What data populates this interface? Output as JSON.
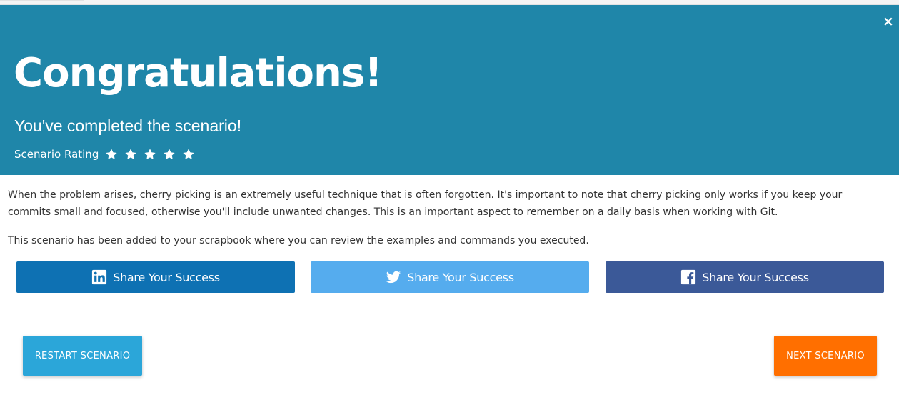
{
  "header": {
    "close_label": "×",
    "title": "Congratulations!",
    "subtitle": "You've completed the scenario!",
    "rating": {
      "label": "Scenario Rating",
      "stars": 5,
      "icon": "star-icon"
    }
  },
  "content": {
    "paragraph_1": "When the problem arises, cherry picking is an extremely useful technique that is often forgotten. It's important to note that cherry picking only works if you keep your commits small and focused, otherwise you'll include unwanted changes. This is an important aspect to remember on a daily basis when working with Git.",
    "paragraph_2": "This scenario has been added to your scrapbook where you can review the examples and commands you executed."
  },
  "share": [
    {
      "network": "linkedin",
      "icon": "linkedin-icon",
      "label": "Share Your Success",
      "color": "#0e71b3"
    },
    {
      "network": "twitter",
      "icon": "twitter-icon",
      "label": "Share Your Success",
      "color": "#55acee"
    },
    {
      "network": "facebook",
      "icon": "facebook-icon",
      "label": "Share Your Success",
      "color": "#3b5998"
    }
  ],
  "actions": {
    "restart_label": "RESTART SCENARIO",
    "next_label": "NEXT SCENARIO"
  },
  "colors": {
    "header_bg": "#1f86a9",
    "restart_bg": "#2ba6d9",
    "next_bg": "#ff6f00"
  }
}
